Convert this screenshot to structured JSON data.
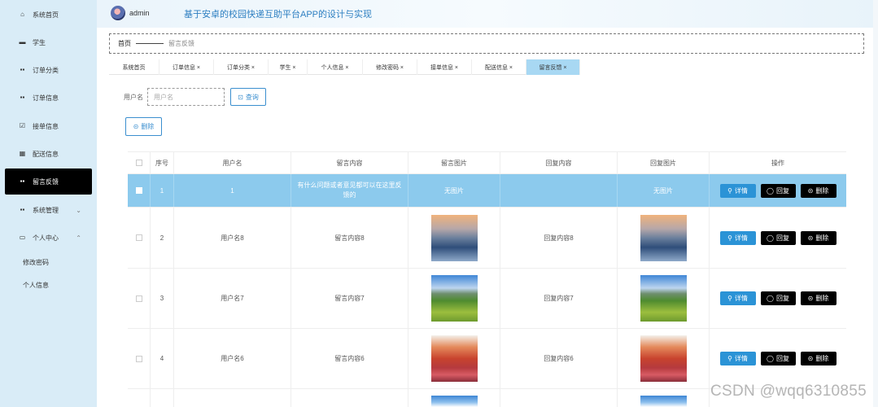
{
  "header": {
    "user": "admin",
    "title": "基于安卓的校园快递互助平台APP的设计与实现"
  },
  "sidebar": {
    "items": [
      {
        "label": "系统首页",
        "icon": "home-icon"
      },
      {
        "label": "学生",
        "icon": "id-card-icon"
      },
      {
        "label": "订单分类",
        "icon": "grid-icon"
      },
      {
        "label": "订单信息",
        "icon": "grid-icon"
      },
      {
        "label": "接单信息",
        "icon": "checklist-icon"
      },
      {
        "label": "配送信息",
        "icon": "clipboard-icon"
      },
      {
        "label": "留言反馈",
        "icon": "grid-icon"
      },
      {
        "label": "系统管理",
        "icon": "grid-icon"
      },
      {
        "label": "个人中心",
        "icon": "window-icon"
      }
    ],
    "sub_items": [
      "修改密码",
      "个人信息"
    ]
  },
  "breadcrumb": {
    "home": "首页",
    "current": "留言反馈"
  },
  "tabs": [
    {
      "label": "系统首页"
    },
    {
      "label": "订单信息 ×"
    },
    {
      "label": "订单分类 ×"
    },
    {
      "label": "学生 ×"
    },
    {
      "label": "个人信息 ×"
    },
    {
      "label": "修改密码 ×"
    },
    {
      "label": "接单信息 ×"
    },
    {
      "label": "配送信息 ×"
    },
    {
      "label": "留言反馈 ×"
    }
  ],
  "search": {
    "label": "用户名",
    "placeholder": "用户名",
    "query_button": "查询",
    "delete_button": "删除"
  },
  "table": {
    "columns": [
      "序号",
      "用户名",
      "留言内容",
      "留言图片",
      "回复内容",
      "回复图片",
      "操作"
    ],
    "rows": [
      {
        "index": "1",
        "username": "1",
        "content": "有什么问题或者意见都可以在这里反馈的",
        "image_text": "无图片",
        "reply": "",
        "reply_image_text": "无图片",
        "image": "none"
      },
      {
        "index": "2",
        "username": "用户名8",
        "content": "留言内容8",
        "image_text": "",
        "reply": "回复内容8",
        "reply_image_text": "",
        "image": "lake"
      },
      {
        "index": "3",
        "username": "用户名7",
        "content": "留言内容7",
        "image_text": "",
        "reply": "回复内容7",
        "reply_image_text": "",
        "image": "meadow"
      },
      {
        "index": "4",
        "username": "用户名6",
        "content": "留言内容6",
        "image_text": "",
        "reply": "回复内容6",
        "reply_image_text": "",
        "image": "autumn"
      }
    ],
    "actions": {
      "detail": "详情",
      "reply": "回复",
      "delete": "删除"
    }
  },
  "watermark": "CSDN @wqq6310855"
}
